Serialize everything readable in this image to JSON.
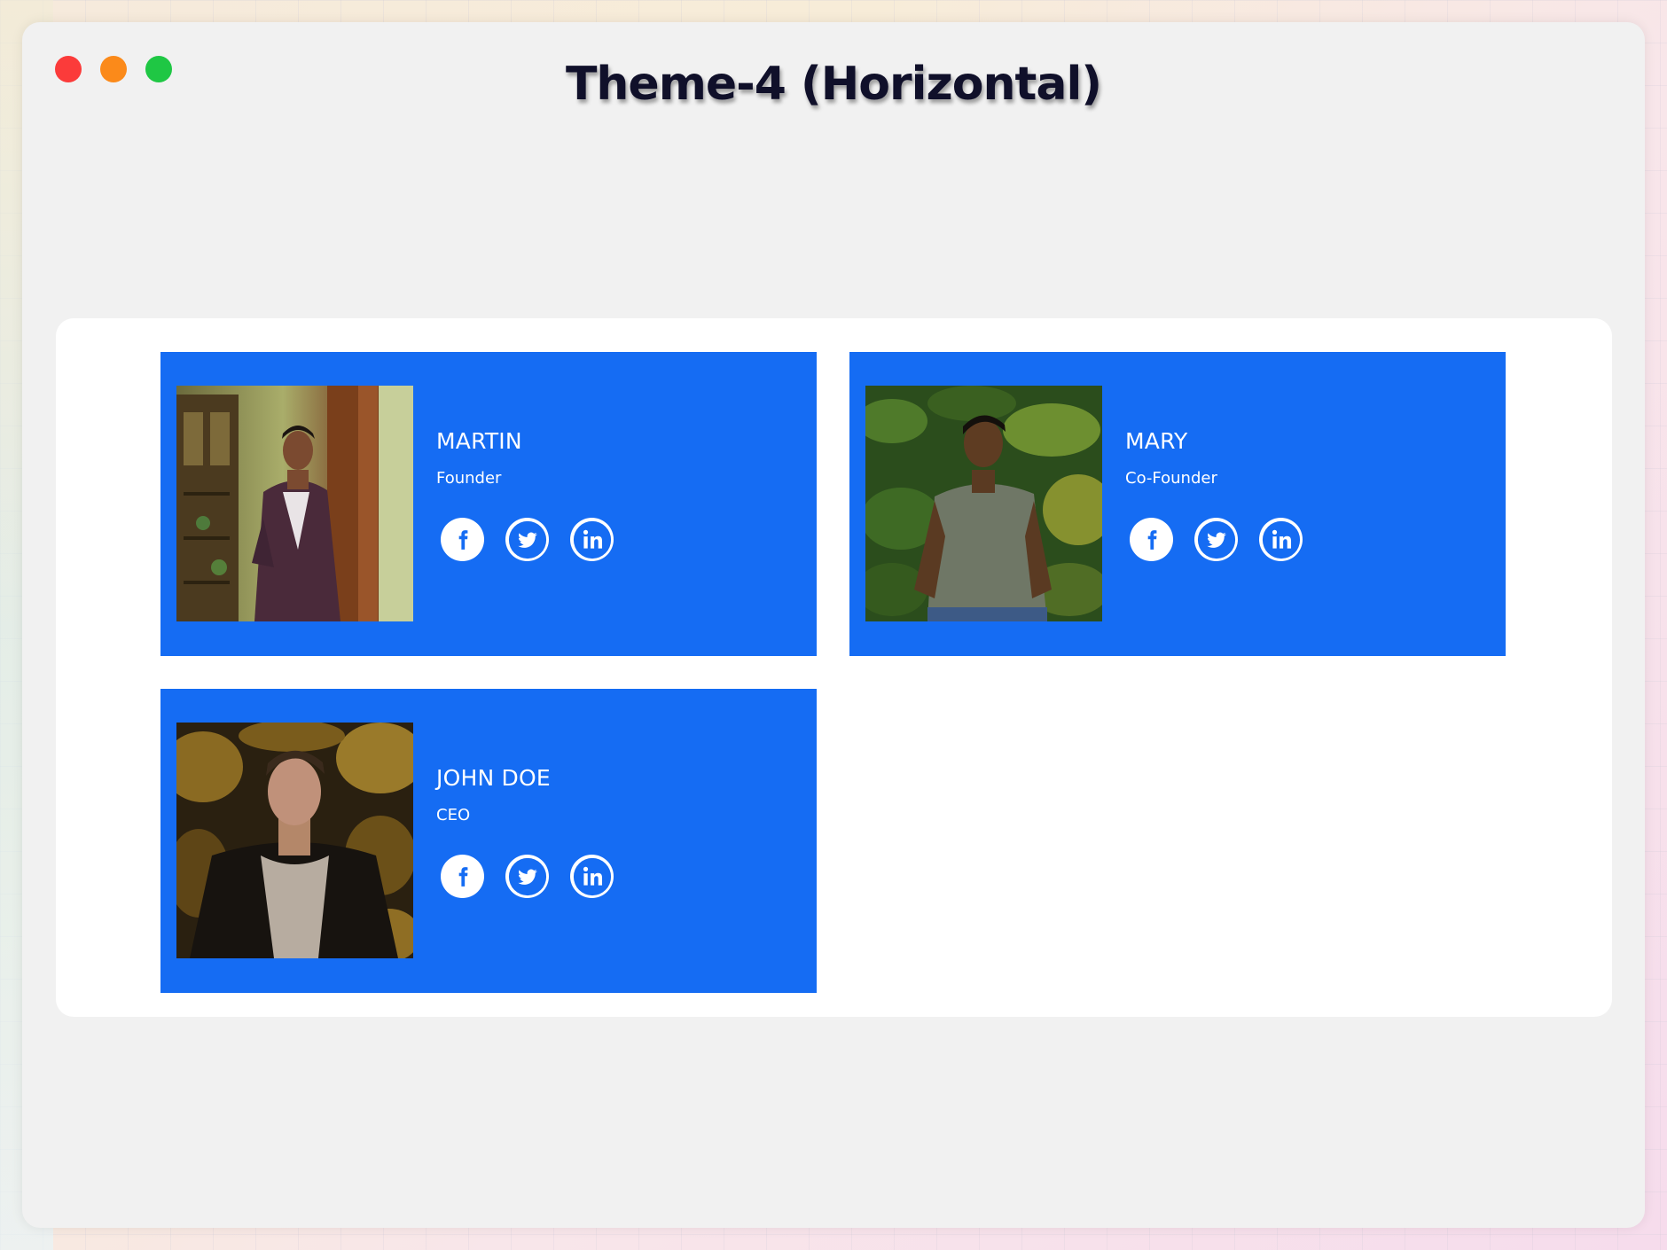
{
  "window": {
    "title": "Theme-4 (Horizontal)",
    "controls": [
      {
        "name": "close",
        "color": "#ff3b30"
      },
      {
        "name": "minimize",
        "color": "#ff9500"
      },
      {
        "name": "maximize",
        "color": "#28cd41"
      }
    ]
  },
  "theme": {
    "card_color": "#156cf3",
    "panel_color": "#ffffff",
    "window_color": "#f1f1f1"
  },
  "members": [
    {
      "name": "MARTIN",
      "role": "Founder",
      "photo": "man-in-suit-photo",
      "socials": [
        "facebook-icon",
        "twitter-icon",
        "linkedin-icon"
      ]
    },
    {
      "name": "MARY",
      "role": "Co-Founder",
      "photo": "boy-in-foliage-photo",
      "socials": [
        "facebook-icon",
        "twitter-icon",
        "linkedin-icon"
      ]
    },
    {
      "name": "JOHN DOE",
      "role": "CEO",
      "photo": "man-in-leather-jacket-photo",
      "socials": [
        "facebook-icon",
        "twitter-icon",
        "linkedin-icon"
      ]
    }
  ]
}
